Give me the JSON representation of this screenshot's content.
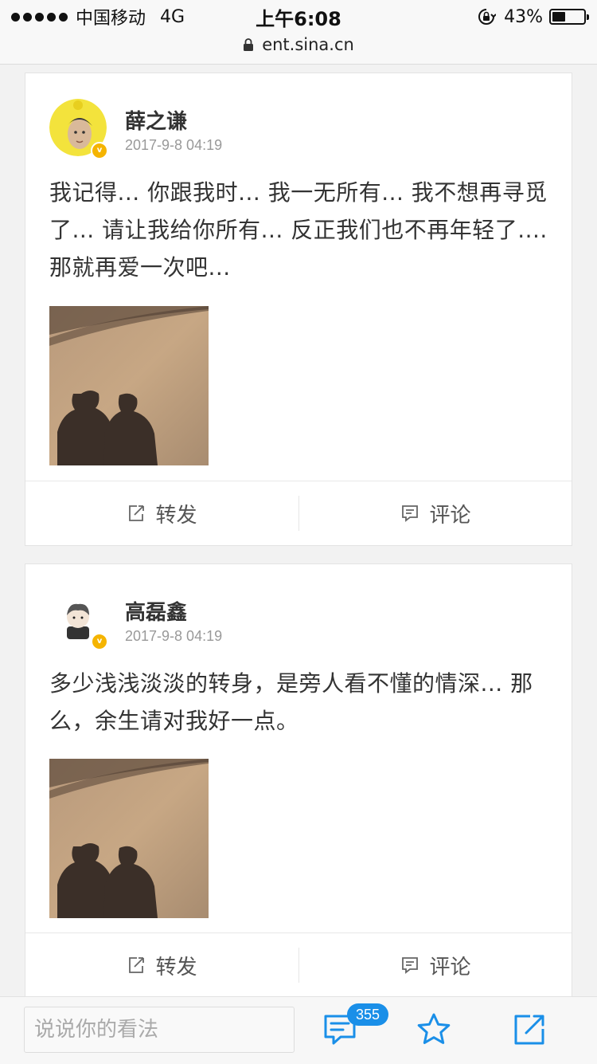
{
  "status_bar": {
    "carrier": "中国移动",
    "network": "4G",
    "time": "上午6:08",
    "battery": "43%",
    "battery_level": 0.43
  },
  "address_bar": {
    "url": "ent.sina.cn"
  },
  "posts": [
    {
      "username": "薛之谦",
      "timestamp": "2017-9-8 04:19",
      "text": "我记得... 你跟我时... 我一无所有... 我不想再寻觅了... 请让我给你所有... 反正我们也不再年轻了.... 那就再爱一次吧...",
      "verified_badge": "v",
      "repost_label": "转发",
      "comment_label": "评论"
    },
    {
      "username": "高磊鑫",
      "timestamp": "2017-9-8 04:19",
      "text": "多少浅浅淡淡的转身，是旁人看不懂的情深... 那么，余生请对我好一点。",
      "verified_badge": "v",
      "repost_label": "转发",
      "comment_label": "评论"
    }
  ],
  "bottom_bar": {
    "comment_placeholder": "说说你的看法",
    "comment_count": "355"
  },
  "colors": {
    "accent": "#1a8fe8",
    "verified": "#f5b400",
    "text": "#333333",
    "muted": "#999999"
  },
  "icons": [
    "signal-dots-icon",
    "rotation-lock-icon",
    "battery-icon",
    "padlock-icon",
    "repost-icon",
    "comment-icon",
    "comments-icon",
    "star-icon",
    "share-icon"
  ]
}
